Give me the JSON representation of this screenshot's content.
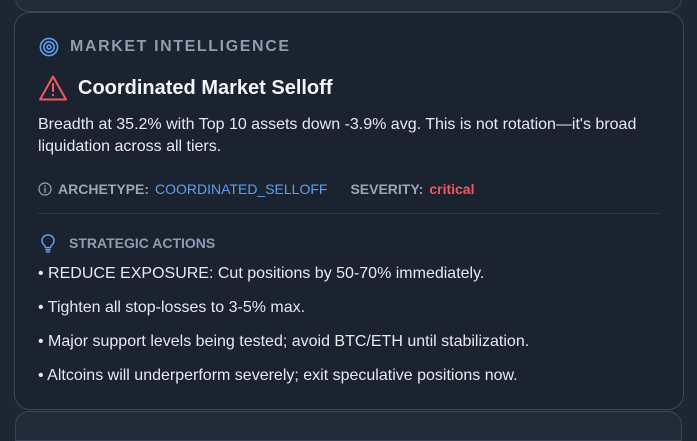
{
  "panel": {
    "section_title": "MARKET INTELLIGENCE",
    "section_icon": "target-icon",
    "alert": {
      "icon": "warning-triangle-icon",
      "title": "Coordinated Market Selloff",
      "description": "Breadth at 35.2% with Top 10 assets down -3.9% avg. This is not rotation—it's broad liquidation across all tiers."
    },
    "meta": {
      "info_icon": "info-icon",
      "archetype_label": "ARCHETYPE:",
      "archetype_value": "COORDINATED_SELLOFF",
      "severity_label": "SEVERITY:",
      "severity_value": "critical"
    },
    "actions": {
      "icon": "lightbulb-icon",
      "title": "STRATEGIC ACTIONS",
      "items": [
        "• REDUCE EXPOSURE: Cut positions by 50-70% immediately.",
        "• Tighten all stop-losses to 3-5% max.",
        "• Major support levels being tested; avoid BTC/ETH until stabilization.",
        "• Altcoins will underperform severely; exit speculative positions now."
      ]
    }
  },
  "colors": {
    "background": "#1f2633",
    "card": "#1b2230",
    "accent_blue": "#5ba0f2",
    "critical_red": "#f05a5f"
  }
}
